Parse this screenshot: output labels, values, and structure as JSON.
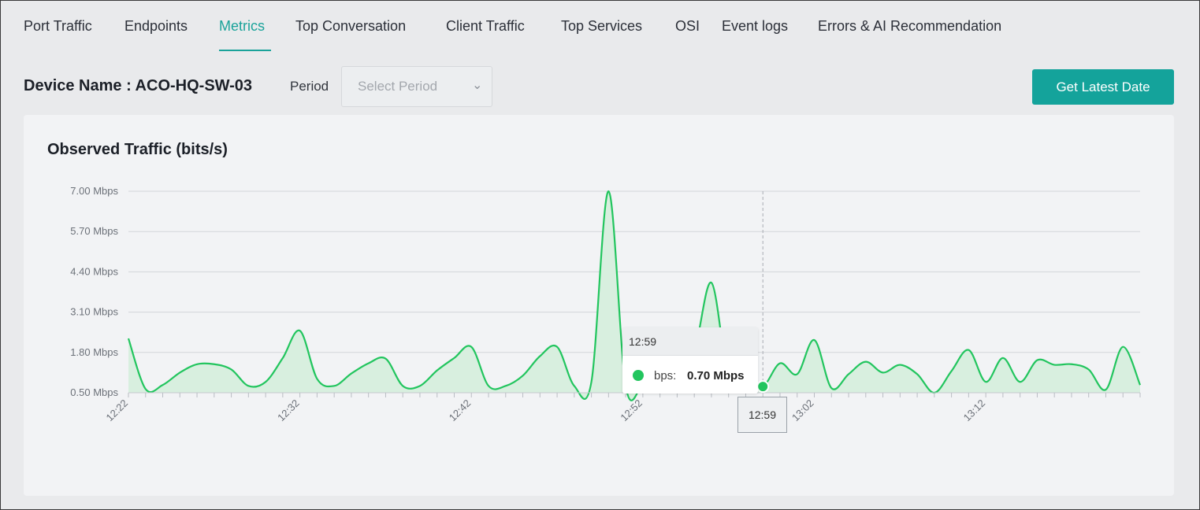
{
  "tabs": [
    {
      "label": "Port Traffic",
      "active": false
    },
    {
      "label": "Endpoints",
      "active": false
    },
    {
      "label": "Metrics",
      "active": true
    },
    {
      "label": "Top Conversation",
      "active": false
    },
    {
      "label": "Client Traffic",
      "active": false
    },
    {
      "label": "Top Services",
      "active": false
    },
    {
      "label": "OSI",
      "active": false
    },
    {
      "label": "Event logs",
      "active": false
    },
    {
      "label": "Errors & AI Recommendation",
      "active": false
    }
  ],
  "device": {
    "label": "Device Name : ACO-HQ-SW-03"
  },
  "period": {
    "label": "Period",
    "placeholder": "Select Period"
  },
  "latest_button": {
    "label": "Get Latest Date"
  },
  "colors": {
    "accent": "#14a39b",
    "series": "#22c55e",
    "area": "#d8efdf"
  },
  "tooltip": {
    "time": "12:59",
    "series_label": "bps:",
    "value": "0.70 Mbps"
  },
  "x_tooltip": "12:59",
  "chart_data": {
    "type": "area",
    "title": "Observed Traffic (bits/s)",
    "y_ticks": [
      "7.00 Mbps",
      "5.70 Mbps",
      "4.40 Mbps",
      "3.10 Mbps",
      "1.80 Mbps",
      "0.50 Mbps"
    ],
    "ylim": [
      0.5,
      7.0
    ],
    "x_tick_labels": [
      "12:22",
      "12:32",
      "12:42",
      "12:52",
      "13:02",
      "13:12"
    ],
    "x_minutes": [
      "12:22",
      "12:23",
      "12:24",
      "12:25",
      "12:26",
      "12:27",
      "12:28",
      "12:29",
      "12:30",
      "12:31",
      "12:32",
      "12:33",
      "12:34",
      "12:35",
      "12:36",
      "12:37",
      "12:38",
      "12:39",
      "12:40",
      "12:41",
      "12:42",
      "12:43",
      "12:44",
      "12:45",
      "12:46",
      "12:47",
      "12:48",
      "12:49",
      "12:50",
      "12:51",
      "12:52",
      "12:53",
      "12:54",
      "12:55",
      "12:56",
      "12:57",
      "12:58",
      "12:59",
      "13:00",
      "13:01",
      "13:02",
      "13:03",
      "13:04",
      "13:05",
      "13:06",
      "13:07",
      "13:08",
      "13:09",
      "13:10",
      "13:11",
      "13:12",
      "13:13",
      "13:14",
      "13:15",
      "13:16",
      "13:17",
      "13:18",
      "13:19",
      "13:20",
      "13:21"
    ],
    "series": [
      {
        "values": [
          2.25,
          0.62,
          0.75,
          1.15,
          1.42,
          1.42,
          1.25,
          0.72,
          0.85,
          1.62,
          2.5,
          0.95,
          0.72,
          1.12,
          1.45,
          1.6,
          0.72,
          0.72,
          1.22,
          1.62,
          1.98,
          0.72,
          0.72,
          1.05,
          1.68,
          1.98,
          0.72,
          0.85,
          7.0,
          0.72,
          0.75,
          1.1,
          1.42,
          1.85,
          4.05,
          0.95,
          0.9,
          0.7,
          1.45,
          1.1,
          2.2,
          0.65,
          1.1,
          1.5,
          1.15,
          1.4,
          1.1,
          0.5,
          1.2,
          1.88,
          0.85,
          1.62,
          0.85,
          1.55,
          1.4,
          1.42,
          1.25,
          0.6,
          1.98,
          0.75
        ]
      }
    ],
    "highlight_index": 37,
    "grid": true,
    "legend": "none"
  }
}
